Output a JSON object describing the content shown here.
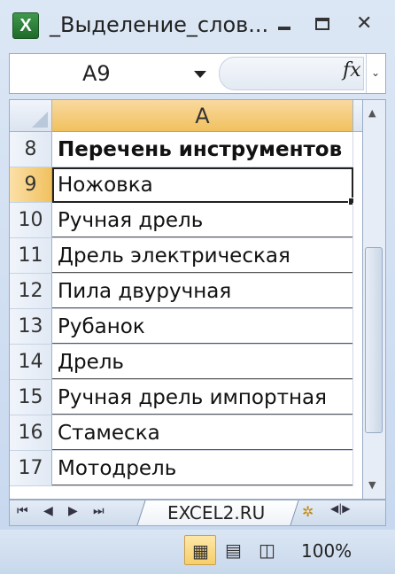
{
  "window": {
    "title": "_Выделение_слов...",
    "app_icon_letter": "X"
  },
  "formula_bar": {
    "name_box": "A9",
    "fx_label": "fx"
  },
  "sheet": {
    "column_header": "A",
    "rows": [
      {
        "num": "8",
        "value": "Перечень инструментов"
      },
      {
        "num": "9",
        "value": "Ножовка"
      },
      {
        "num": "10",
        "value": "Ручная дрель"
      },
      {
        "num": "11",
        "value": "Дрель электрическая"
      },
      {
        "num": "12",
        "value": "Пила двуручная"
      },
      {
        "num": "13",
        "value": "Рубанок"
      },
      {
        "num": "14",
        "value": "Дрель"
      },
      {
        "num": "15",
        "value": "Ручная дрель импортная"
      },
      {
        "num": "16",
        "value": "Стамеска"
      },
      {
        "num": "17",
        "value": "Мотодрель"
      }
    ]
  },
  "tabs": {
    "active_sheet": "EXCEL2.RU"
  },
  "status_bar": {
    "zoom": "100%"
  },
  "colors": {
    "selection_header": "#f1c15f",
    "excel_green": "#1e6a2a"
  }
}
